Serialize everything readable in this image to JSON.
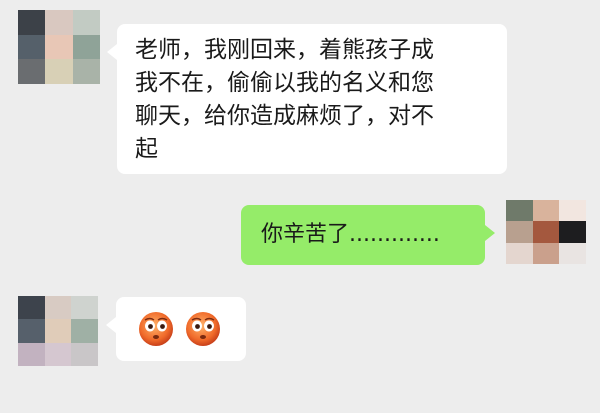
{
  "messages": [
    {
      "sender": "other",
      "lines": [
        "老师，我刚回来，着熊孩子成",
        "我不在，偷偷以我的名义和您",
        "聊天，给你造成麻烦了，对不",
        "起"
      ]
    },
    {
      "sender": "self",
      "text": "你辛苦了............."
    },
    {
      "sender": "other",
      "emojis": [
        "flushed-face-icon",
        "flushed-face-icon"
      ]
    }
  ],
  "colors": {
    "background": "#ededed",
    "incoming_bubble": "#ffffff",
    "outgoing_bubble": "#95ec69",
    "text": "#1a1a1a"
  }
}
